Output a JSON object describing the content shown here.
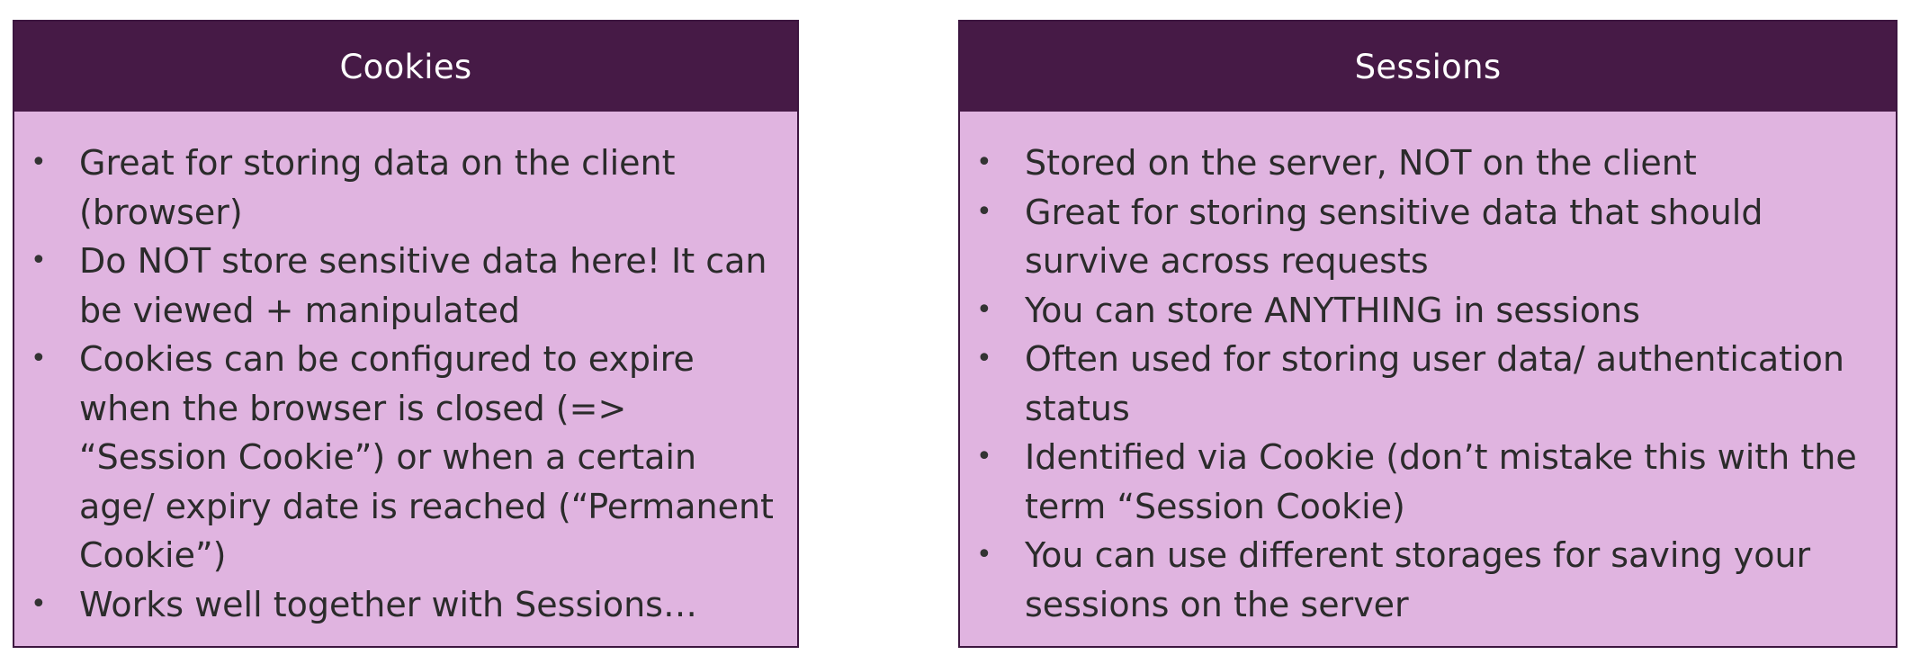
{
  "cookies": {
    "title": "Cookies",
    "items": [
      "Great for storing data on the client (browser)",
      "Do NOT store sensitive data here! It can be viewed + manipulated",
      "Cookies can be configured to expire when the browser is closed (=> “Session Cookie”) or when a certain age/ expiry date is reached (“Permanent Cookie”)",
      "Works well together with Sessions…"
    ]
  },
  "sessions": {
    "title": "Sessions",
    "items": [
      "Stored on the server, NOT on the client",
      "Great for storing sensitive data that should survive across requests",
      "You can store ANYTHING in sessions",
      "Often used for storing user data/ authentication status",
      "Identified via Cookie (don’t mistake this with the term “Session Cookie)",
      "You can use different storages for saving your sessions on the server"
    ]
  },
  "colors": {
    "header_bg": "#461a46",
    "card_bg": "#e0b4e0",
    "border": "#3d1640",
    "header_text": "#ffffff",
    "body_text": "#2b2b2b"
  }
}
